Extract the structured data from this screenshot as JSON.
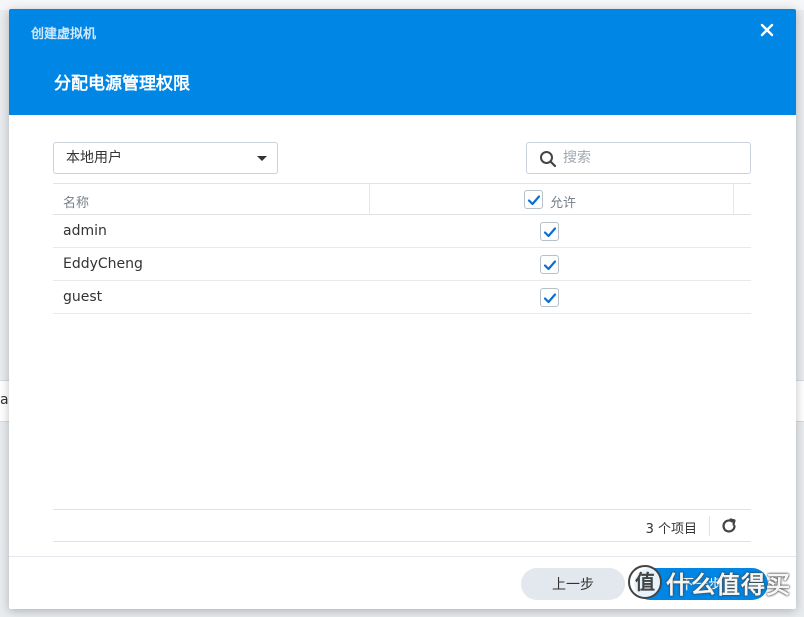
{
  "window": {
    "app_title": "创建虚拟机",
    "step_title": "分配电源管理权限"
  },
  "filter": {
    "selected": "本地用户"
  },
  "search": {
    "placeholder": "搜索",
    "value": ""
  },
  "table": {
    "columns": {
      "name": "名称",
      "allow": "允许"
    },
    "rows": [
      {
        "name": "admin",
        "allowed": true
      },
      {
        "name": "EddyCheng",
        "allowed": true
      },
      {
        "name": "guest",
        "allowed": true
      }
    ],
    "footer": {
      "count_label": "3 个项目"
    }
  },
  "buttons": {
    "prev": "上一步",
    "next": "下一步"
  },
  "watermark": {
    "text": "什么值得买",
    "logo_char": "值"
  },
  "background": {
    "partial_char": "a"
  },
  "colors": {
    "accent": "#0086e5",
    "check": "#0a6fd1"
  }
}
